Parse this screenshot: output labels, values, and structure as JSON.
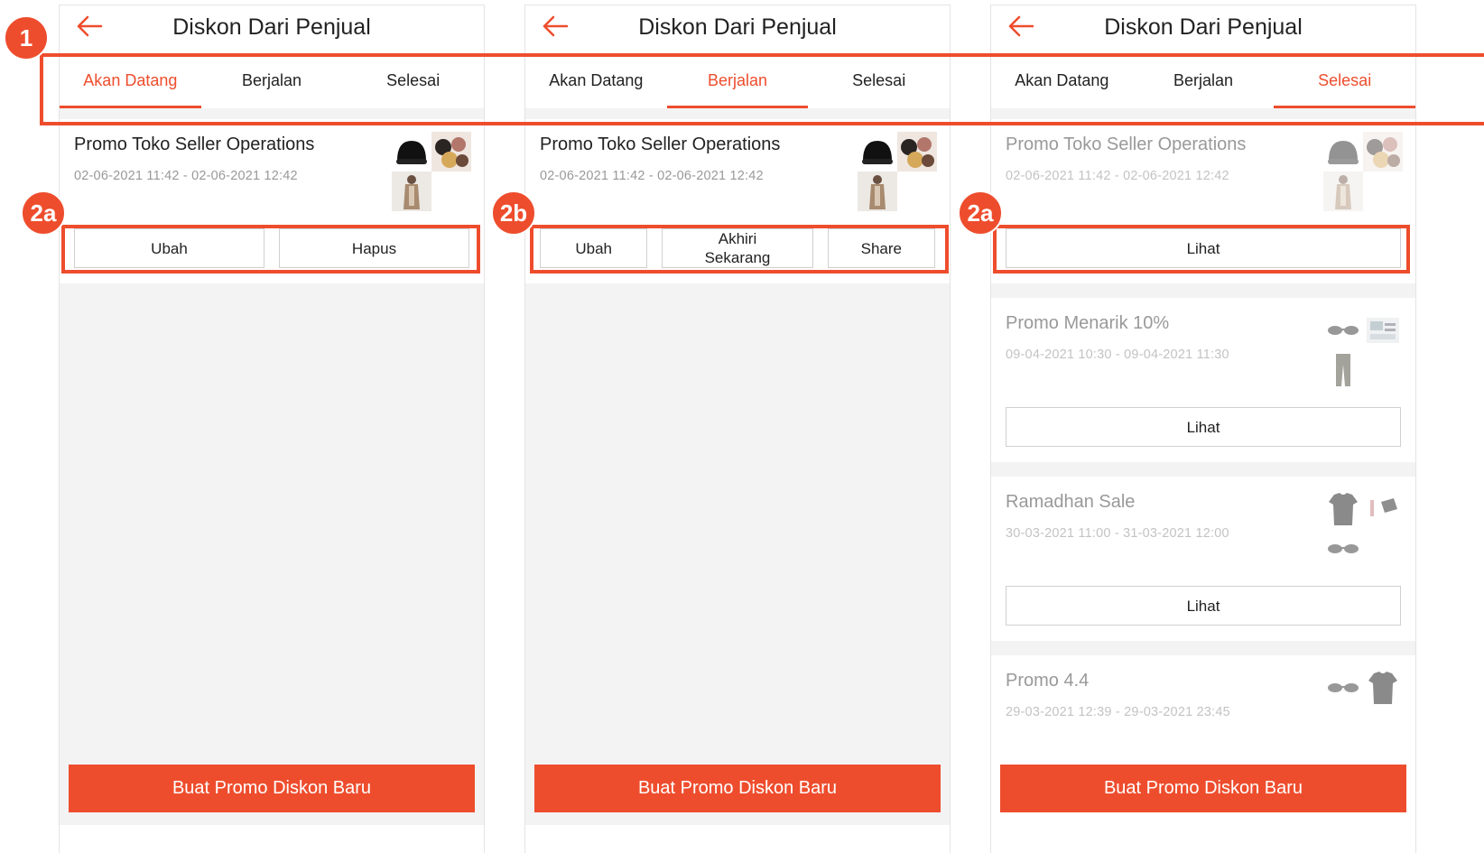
{
  "screen_title": "Diskon Dari Penjual",
  "tabs": {
    "upcoming": "Akan Datang",
    "ongoing": "Berjalan",
    "finished": "Selesai"
  },
  "accent_color": "#ee4d2d",
  "screens": [
    {
      "active_tab": "Akan Datang"
    },
    {
      "active_tab": "Berjalan"
    },
    {
      "active_tab": "Selesai"
    }
  ],
  "promo_main": {
    "name": "Promo Toko Seller Operations",
    "period": "02-06-2021 11:42 - 02-06-2021 12:42"
  },
  "buttons": {
    "edit": "Ubah",
    "delete": "Hapus",
    "end_now": "Akhiri Sekarang",
    "share": "Share",
    "view": "Lihat"
  },
  "finished_promos": [
    {
      "name": "Promo Menarik 10%",
      "period": "09-04-2021 10:30 - 09-04-2021 11:30"
    },
    {
      "name": "Ramadhan Sale",
      "period": "30-03-2021 11:00 - 31-03-2021 12:00"
    },
    {
      "name": "Promo 4.4",
      "period": "29-03-2021 12:39 - 29-03-2021 23:45"
    }
  ],
  "cta_label": "Buat Promo Diskon Baru",
  "annotations": {
    "badge1": "1",
    "badge2a": "2a",
    "badge2b": "2b"
  }
}
